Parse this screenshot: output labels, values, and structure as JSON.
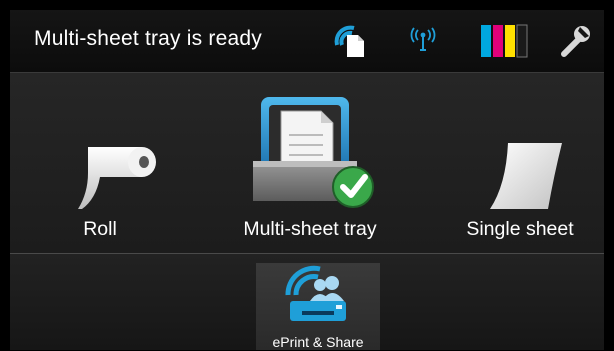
{
  "status_bar": {
    "message": "Multi-sheet tray is ready",
    "icons": [
      "network-paper-icon",
      "wireless-icon",
      "ink-cartridges-icon",
      "wrench-icon"
    ],
    "ink_colors": [
      "#00a8e0",
      "#e0007a",
      "#ffe000",
      "#1a1a1a"
    ]
  },
  "media": {
    "items": [
      {
        "id": "roll",
        "label": "Roll",
        "icon": "paper-roll-icon"
      },
      {
        "id": "multi-sheet-tray",
        "label": "Multi-sheet tray",
        "icon": "tray-icon",
        "selected": true
      },
      {
        "id": "single-sheet",
        "label": "Single sheet",
        "icon": "single-sheet-icon"
      }
    ]
  },
  "apps": {
    "eprint_label": "ePrint & Share",
    "eprint_icon": "eprint-share-icon"
  },
  "colors": {
    "accent_blue": "#1f9fd8",
    "check_green": "#3aa84a"
  }
}
